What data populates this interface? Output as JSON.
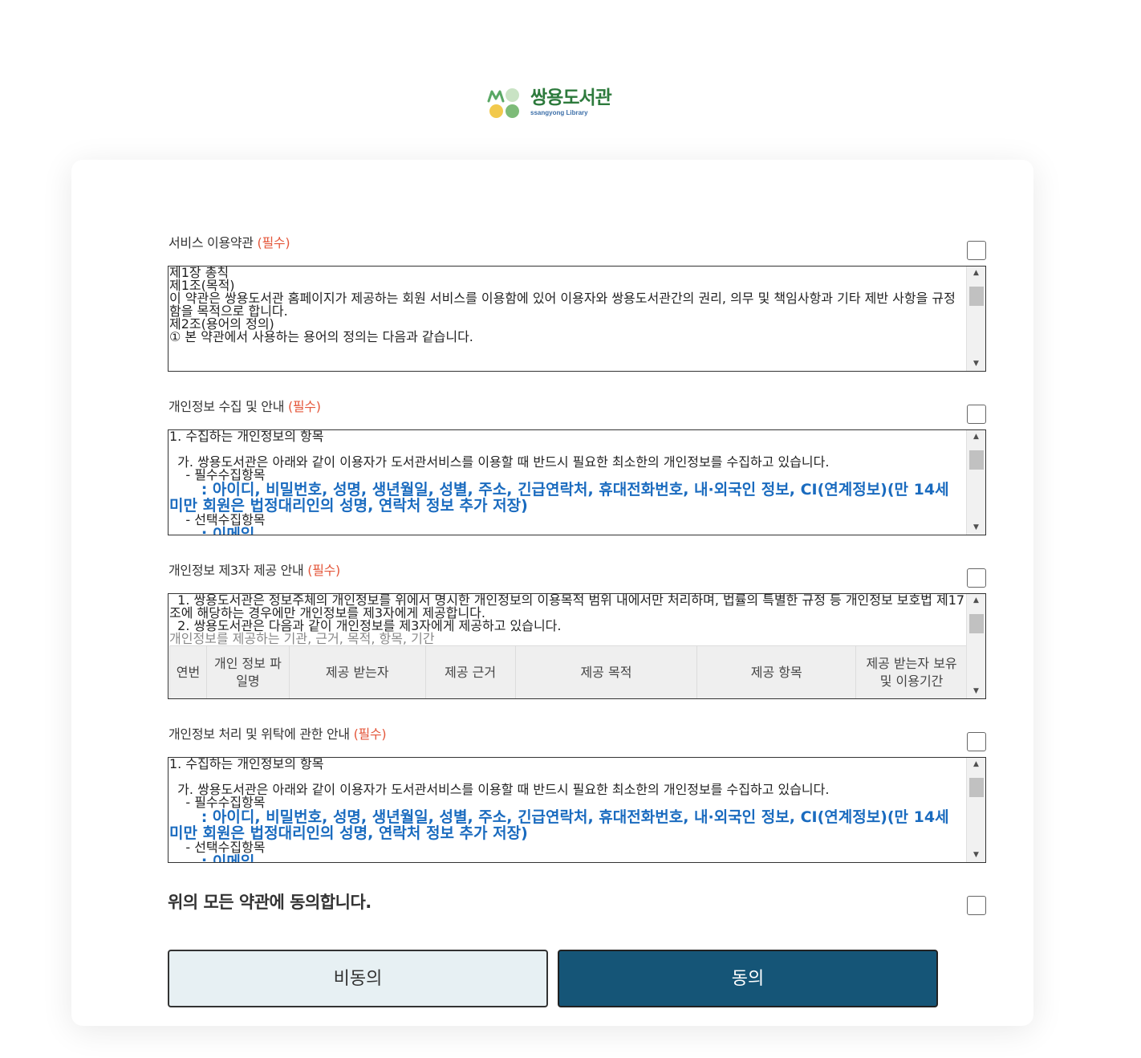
{
  "logo": {
    "name_ko": "쌍용도서관",
    "name_en": "ssangyong Library"
  },
  "sections": [
    {
      "title": "서비스 이용약관",
      "required": "(필수)",
      "lines": [
        "제1장 총칙",
        "",
        "제1조(목적)",
        "이 약관은 쌍용도서관 홈페이지가 제공하는 회원 서비스를 이용함에 있어 이용자와 쌍용도서관간의 권리, 의무 및 책임사항과 기타 제반 사항을 규정함을 목적으로 합니다.",
        "",
        "제2조(용어의 정의)",
        "① 본 약관에서 사용하는 용어의 정의는 다음과 같습니다."
      ]
    },
    {
      "title": "개인정보 수집 및 안내",
      "required": "(필수)",
      "heading": "1. 수집하는 개인정보의 항목",
      "item_a": "  가. 쌍용도서관은 아래와 같이 이용자가 도서관서비스를 이용할 때 반드시 필요한 최소한의 개인정보를 수집하고 있습니다.",
      "required_items_label": "    - 필수수집항목",
      "required_items": "아이디, 비밀번호, 성명, 생년월일, 성별, 주소, 긴급연락처, 휴대전화번호, 내·외국인 정보, CI(연계정보)(만 14세 미만 회원은 법정대리인의 성명, 연락처 정보 추가 저장)",
      "optional_items_label": "    - 선택수집항목",
      "optional_items": "이메일"
    },
    {
      "title": "개인정보 제3자 제공 안내",
      "required": "(필수)",
      "line1": "  1. 쌍용도서관은 정보주체의 개인정보를 위에서 명시한 개인정보의 이용목적 범위 내에서만 처리하며, 법률의 특별한 규정 등 개인정보 보호법 제17조에 해당하는 경우에만 개인정보를 제3자에게 제공합니다.",
      "line2": "  2. 쌍용도서관은 다음과 같이 개인정보를 제3자에게 제공하고 있습니다.",
      "caption": "개인정보를 제공하는 기관, 근거, 목적, 항목, 기간",
      "columns": [
        "연번",
        "개인 정보 파일명",
        "제공 받는자",
        "제공 근거",
        "제공 목적",
        "제공 항목",
        "제공 받는자 보유 및 이용기간"
      ]
    },
    {
      "title": "개인정보 처리 및 위탁에 관한 안내",
      "required": "(필수)",
      "heading": "1. 수집하는 개인정보의 항목",
      "item_a": "  가. 쌍용도서관은 아래와 같이 이용자가 도서관서비스를 이용할 때 반드시 필요한 최소한의 개인정보를 수집하고 있습니다.",
      "required_items_label": "    - 필수수집항목",
      "required_items": "아이디, 비밀번호, 성명, 생년월일, 성별, 주소, 긴급연락처, 휴대전화번호, 내·외국인 정보, CI(연계정보)(만 14세 미만 회원은 법정대리인의 성명, 연락처 정보 추가 저장)",
      "optional_items_label": "    - 선택수집항목",
      "optional_items": "이메일"
    }
  ],
  "all_agree": "위의 모든 약관에 동의합니다.",
  "buttons": {
    "disagree": "비동의",
    "agree": "동의"
  },
  "scrollbar": {
    "up": "▲",
    "down": "▼"
  },
  "colors": {
    "primary": "#155577",
    "secondary": "#e7f0f3",
    "required": "#e4573b",
    "highlight": "#1a6bbf"
  }
}
